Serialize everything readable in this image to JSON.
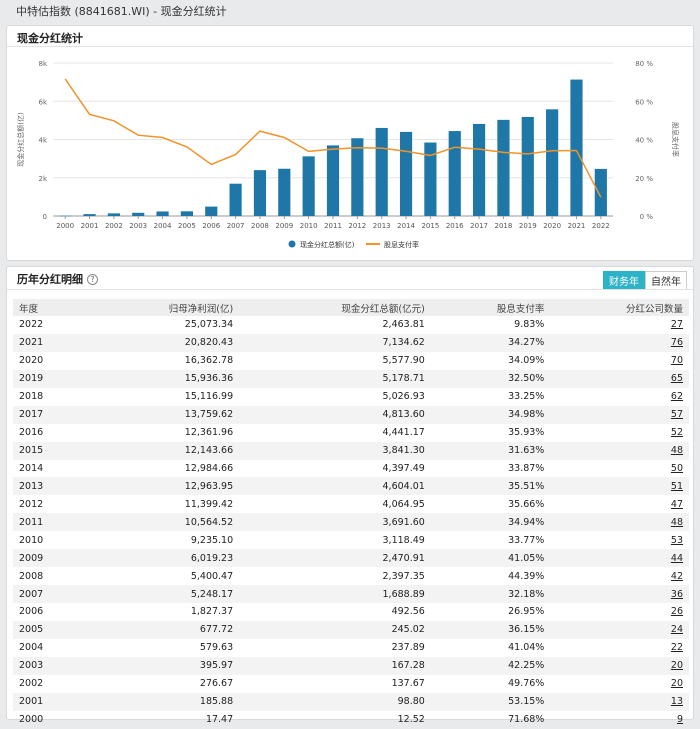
{
  "header": {
    "title": "中特估指数 (8841681.WI) - 现金分红统计"
  },
  "chart_panel": {
    "title": "现金分红统计"
  },
  "chart_data": {
    "type": "bar",
    "categories": [
      "2000",
      "2001",
      "2002",
      "2003",
      "2004",
      "2005",
      "2006",
      "2007",
      "2008",
      "2009",
      "2010",
      "2011",
      "2012",
      "2013",
      "2014",
      "2015",
      "2016",
      "2017",
      "2018",
      "2019",
      "2020",
      "2021",
      "2022"
    ],
    "series": [
      {
        "name": "现金分红总额(亿)",
        "type": "bar",
        "color": "#1f77a8",
        "axis": "left",
        "values": [
          12.52,
          98.8,
          137.67,
          167.28,
          237.89,
          245.02,
          492.56,
          1688.89,
          2397.35,
          2470.91,
          3118.49,
          3691.6,
          4064.95,
          4604.01,
          4397.49,
          3841.3,
          4441.17,
          4813.6,
          5026.93,
          5178.71,
          5577.9,
          7134.62,
          2463.81
        ]
      },
      {
        "name": "股息支付率",
        "type": "line",
        "color": "#f0932a",
        "axis": "right",
        "values": [
          71.68,
          53.15,
          49.76,
          42.25,
          41.04,
          36.15,
          26.95,
          32.18,
          44.39,
          41.05,
          33.77,
          34.94,
          35.66,
          35.51,
          33.87,
          31.63,
          35.93,
          34.98,
          33.25,
          32.5,
          34.09,
          34.27,
          9.83
        ]
      }
    ],
    "ylabel": "现金分红总额(亿)",
    "y2label": "股息支付率",
    "ylim": [
      0,
      8000
    ],
    "y2lim": [
      0,
      80
    ],
    "yticks": [
      "0",
      "2k",
      "4k",
      "6k",
      "8k"
    ],
    "y2ticks": [
      "0 %",
      "20 %",
      "40 %",
      "60 %",
      "80 %"
    ],
    "legend_position": "bottom-center",
    "grid": true
  },
  "table_panel": {
    "title": "历年分红明细",
    "help_icon": "?",
    "tabs": [
      {
        "label": "财务年",
        "active": true
      },
      {
        "label": "自然年",
        "active": false
      }
    ],
    "columns": [
      "年度",
      "归母净利润(亿)",
      "现金分红总额(亿元)",
      "股息支付率",
      "分红公司数量"
    ],
    "rows": [
      [
        "2022",
        "25,073.34",
        "2,463.81",
        "9.83%",
        "27"
      ],
      [
        "2021",
        "20,820.43",
        "7,134.62",
        "34.27%",
        "76"
      ],
      [
        "2020",
        "16,362.78",
        "5,577.90",
        "34.09%",
        "70"
      ],
      [
        "2019",
        "15,936.36",
        "5,178.71",
        "32.50%",
        "65"
      ],
      [
        "2018",
        "15,116.99",
        "5,026.93",
        "33.25%",
        "62"
      ],
      [
        "2017",
        "13,759.62",
        "4,813.60",
        "34.98%",
        "57"
      ],
      [
        "2016",
        "12,361.96",
        "4,441.17",
        "35.93%",
        "52"
      ],
      [
        "2015",
        "12,143.66",
        "3,841.30",
        "31.63%",
        "48"
      ],
      [
        "2014",
        "12,984.66",
        "4,397.49",
        "33.87%",
        "50"
      ],
      [
        "2013",
        "12,963.95",
        "4,604.01",
        "35.51%",
        "51"
      ],
      [
        "2012",
        "11,399.42",
        "4,064.95",
        "35.66%",
        "47"
      ],
      [
        "2011",
        "10,564.52",
        "3,691.60",
        "34.94%",
        "48"
      ],
      [
        "2010",
        "9,235.10",
        "3,118.49",
        "33.77%",
        "53"
      ],
      [
        "2009",
        "6,019.23",
        "2,470.91",
        "41.05%",
        "44"
      ],
      [
        "2008",
        "5,400.47",
        "2,397.35",
        "44.39%",
        "42"
      ],
      [
        "2007",
        "5,248.17",
        "1,688.89",
        "32.18%",
        "36"
      ],
      [
        "2006",
        "1,827.37",
        "492.56",
        "26.95%",
        "26"
      ],
      [
        "2005",
        "677.72",
        "245.02",
        "36.15%",
        "24"
      ],
      [
        "2004",
        "579.63",
        "237.89",
        "41.04%",
        "22"
      ],
      [
        "2003",
        "395.97",
        "167.28",
        "42.25%",
        "20"
      ],
      [
        "2002",
        "276.67",
        "137.67",
        "49.76%",
        "20"
      ],
      [
        "2001",
        "185.88",
        "98.80",
        "53.15%",
        "13"
      ],
      [
        "2000",
        "17.47",
        "12.52",
        "71.68%",
        "9"
      ]
    ]
  }
}
